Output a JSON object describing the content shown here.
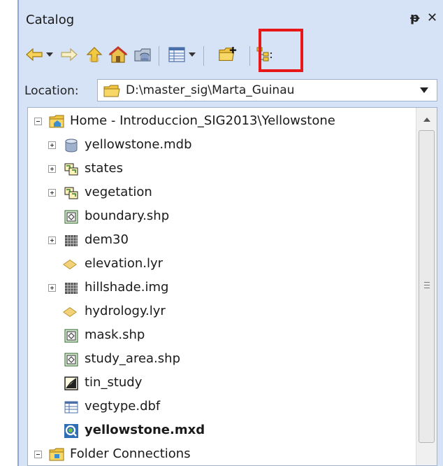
{
  "panel": {
    "title": "Catalog",
    "pin_glyph": "ᵽ",
    "close_glyph": "✕"
  },
  "toolbar": {
    "buttons": [
      {
        "name": "back-button",
        "icon": "back-arrow-icon"
      },
      {
        "name": "back-dropdown",
        "icon": "chevron-down-icon"
      },
      {
        "name": "forward-button",
        "icon": "forward-arrow-icon"
      },
      {
        "name": "up-one-level-button",
        "icon": "up-folder-icon"
      },
      {
        "name": "home-button",
        "icon": "home-icon"
      },
      {
        "name": "default-gdb-button",
        "icon": "geodatabase-icon"
      },
      {
        "name": "views-button",
        "icon": "table-view-icon"
      },
      {
        "name": "views-dropdown",
        "icon": "chevron-down-icon"
      },
      {
        "name": "connect-to-folder-button",
        "icon": "connect-folder-icon",
        "highlighted": true
      },
      {
        "name": "toggle-tree-button",
        "icon": "tree-icon"
      }
    ],
    "highlight_color": "#e81818"
  },
  "location": {
    "label": "Location:",
    "value": "D:\\master_sig\\Marta_Guinau"
  },
  "tree": {
    "items": [
      {
        "label": "Home - Introduccion_SIG2013\\Yellowstone",
        "icon": "home-folder-icon",
        "expander": "minus",
        "level": 0
      },
      {
        "label": "yellowstone.mdb",
        "icon": "database-icon",
        "expander": "plus",
        "level": 1
      },
      {
        "label": "states",
        "icon": "coverage-icon",
        "expander": "plus",
        "level": 1
      },
      {
        "label": "vegetation",
        "icon": "coverage-icon",
        "expander": "plus",
        "level": 1
      },
      {
        "label": "boundary.shp",
        "icon": "shapefile-icon",
        "expander": "none",
        "level": 1
      },
      {
        "label": "dem30",
        "icon": "raster-icon",
        "expander": "plus",
        "level": 1
      },
      {
        "label": "elevation.lyr",
        "icon": "layer-file-icon",
        "expander": "none",
        "level": 1
      },
      {
        "label": "hillshade.img",
        "icon": "raster-icon",
        "expander": "plus",
        "level": 1
      },
      {
        "label": "hydrology.lyr",
        "icon": "layer-file-icon",
        "expander": "none",
        "level": 1
      },
      {
        "label": "mask.shp",
        "icon": "shapefile-icon",
        "expander": "none",
        "level": 1
      },
      {
        "label": "study_area.shp",
        "icon": "shapefile-icon",
        "expander": "none",
        "level": 1
      },
      {
        "label": "tin_study",
        "icon": "tin-icon",
        "expander": "none",
        "level": 1
      },
      {
        "label": "vegtype.dbf",
        "icon": "table-icon",
        "expander": "none",
        "level": 1
      },
      {
        "label": "yellowstone.mxd",
        "icon": "map-document-icon",
        "expander": "none",
        "level": 1,
        "bold": true
      },
      {
        "label": "Folder Connections",
        "icon": "folder-connections-icon",
        "expander": "minus",
        "level": 0
      }
    ]
  }
}
